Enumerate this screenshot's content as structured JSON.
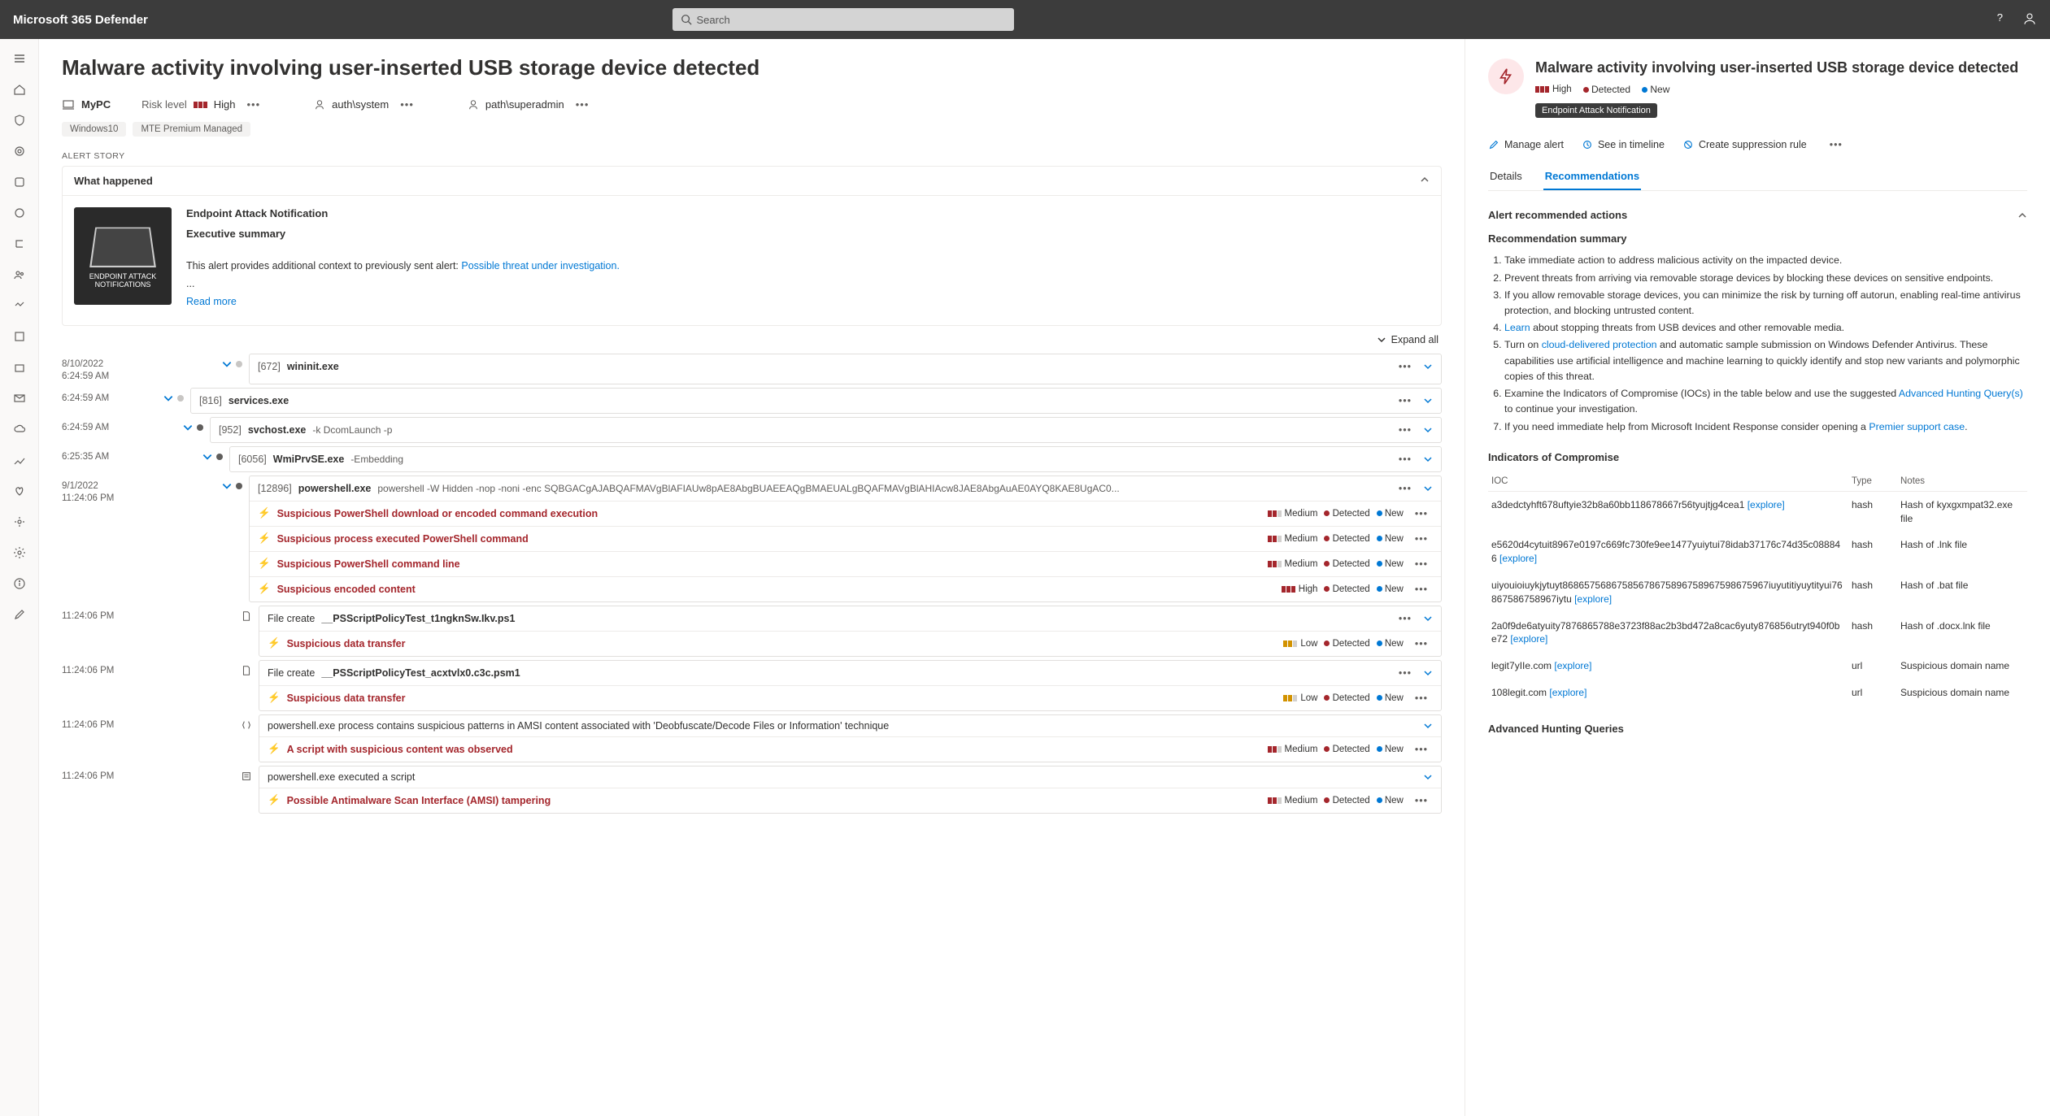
{
  "header": {
    "product": "Microsoft 365 Defender",
    "search_placeholder": "Search"
  },
  "page": {
    "title": "Malware activity involving user-inserted USB storage device detected",
    "device": "MyPC",
    "risk_label": "Risk level",
    "risk_value": "High",
    "user1": "auth\\system",
    "user2": "path\\superadmin",
    "tags": [
      "Windows10",
      "MTE Premium Managed"
    ]
  },
  "story": {
    "section_label": "ALERT STORY",
    "heading": "What happened",
    "ean_title": "Endpoint Attack Notification",
    "exec_sum": "Executive summary",
    "context1": "This alert provides additional context to previously sent alert: ",
    "context_link": "Possible threat under investigation.",
    "ellipsis": "...",
    "read_more": "Read more",
    "expand_all": "Expand all",
    "badge_line1": "ENDPOINT ATTACK",
    "badge_line2": "NOTIFICATIONS"
  },
  "tree": [
    {
      "time1": "8/10/2022",
      "time2": "6:24:59 AM",
      "pid": "[672]",
      "exe": "wininit.exe",
      "args": ""
    },
    {
      "time1": "",
      "time2": "6:24:59 AM",
      "pid": "[816]",
      "exe": "services.exe",
      "args": ""
    },
    {
      "time1": "",
      "time2": "6:24:59 AM",
      "pid": "[952]",
      "exe": "svchost.exe",
      "args": "-k DcomLaunch -p"
    },
    {
      "time1": "",
      "time2": "6:25:35 AM",
      "pid": "[6056]",
      "exe": "WmiPrvSE.exe",
      "args": "-Embedding"
    },
    {
      "time1": "9/1/2022",
      "time2": "11:24:06 PM",
      "pid": "[12896]",
      "exe": "powershell.exe",
      "args": "powershell -W Hidden -nop -noni -enc SQBGACgAJABQAFMAVgBlAFIAUw8pAE8AbgBUAEEAQgBMAEUALgBQAFMAVgBlAHIAcw8JAE8AbgAuAE0AYQ8KAE8UgAC0..."
    }
  ],
  "alerts_ps": [
    {
      "name": "Suspicious PowerShell download or encoded command execution",
      "sev": "Medium",
      "status": "Detected",
      "state": "New"
    },
    {
      "name": "Suspicious process executed PowerShell command",
      "sev": "Medium",
      "status": "Detected",
      "state": "New"
    },
    {
      "name": "Suspicious PowerShell command line",
      "sev": "Medium",
      "status": "Detected",
      "state": "New"
    },
    {
      "name": "Suspicious encoded content",
      "sev": "High",
      "status": "Detected",
      "state": "New"
    }
  ],
  "file1": {
    "time": "11:24:06 PM",
    "head_pre": "File create",
    "head_post": "__PSScriptPolicyTest_t1ngknSw.Ikv.ps1",
    "alert": {
      "name": "Suspicious data transfer",
      "sev": "Low",
      "status": "Detected",
      "state": "New"
    }
  },
  "file2": {
    "time": "11:24:06 PM",
    "head_pre": "File create",
    "head_post": "__PSScriptPolicyTest_acxtvlx0.c3c.psm1",
    "alert": {
      "name": "Suspicious data transfer",
      "sev": "Low",
      "status": "Detected",
      "state": "New"
    }
  },
  "amsi": {
    "time": "11:24:06 PM",
    "head": "powershell.exe process contains suspicious patterns in AMSI content associated with 'Deobfuscate/Decode Files or Information' technique",
    "alert": {
      "name": "A script with suspicious content was observed",
      "sev": "Medium",
      "status": "Detected",
      "state": "New"
    }
  },
  "script": {
    "time": "11:24:06 PM",
    "head": "powershell.exe executed a script",
    "alert": {
      "name": "Possible Antimalware Scan Interface (AMSI) tampering",
      "sev": "Medium",
      "status": "Detected",
      "state": "New"
    }
  },
  "panel": {
    "title": "Malware activity involving user-inserted USB storage device detected",
    "sev": "High",
    "status": "Detected",
    "state": "New",
    "ean_tag": "Endpoint Attack Notification",
    "actions": {
      "manage": "Manage alert",
      "timeline": "See in timeline",
      "suppress": "Create suppression rule"
    },
    "tabs": {
      "details": "Details",
      "recs": "Recommendations"
    },
    "alert_rec_h": "Alert recommended actions",
    "rec_sum_h": "Recommendation summary",
    "recs": [
      {
        "pre": "Take immediate action to address malicious activity on the impacted device."
      },
      {
        "pre": "Prevent threats from arriving via removable storage devices by blocking these devices on sensitive endpoints."
      },
      {
        "pre": "If you allow removable storage devices, you can minimize the risk by turning off autorun, enabling real-time antivirus protection, and blocking untrusted content."
      },
      {
        "link_first": true,
        "link": "Learn",
        "post": " about stopping threats from USB devices and other removable media."
      },
      {
        "pre": "Turn on ",
        "link": "cloud-delivered protection",
        "post": " and automatic sample submission on Windows Defender Antivirus. These capabilities use artificial intelligence and machine learning to quickly identify and stop new variants and polymorphic copies of this threat."
      },
      {
        "pre": "Examine the Indicators of Compromise (IOCs) in the table below and use the suggested ",
        "link": "Advanced Hunting Query(s)",
        "post": " to continue your investigation."
      },
      {
        "pre": "If you need immediate help from Microsoft Incident Response consider opening a ",
        "link": "Premier support case",
        "post": "."
      }
    ],
    "ioc_h": "Indicators of Compromise",
    "ioc_cols": {
      "ioc": "IOC",
      "type": "Type",
      "notes": "Notes"
    },
    "ioc": [
      {
        "ioc": "a3dedctyhft678uftyie32b8a60bb118678667r56tyujtjg4cea1",
        "type": "hash",
        "notes": "Hash of kyxgxmpat32.exe file"
      },
      {
        "ioc": "e5620d4cytuit8967e0197c669fc730fe9ee1477yuiytui78idab37176c74d35c088846",
        "type": "hash",
        "notes": "Hash of <FILE_NAME>.lnk file"
      },
      {
        "ioc": "uiyouioiuykjytuyt86865756867585678675896758967598675967iuyutitiyuytityui76867586758967iytu",
        "type": "hash",
        "notes": "Hash of <FILE_NAME>.bat file"
      },
      {
        "ioc": "2a0f9de6atyuity7876865788e3723f88ac2b3bd472a8cac6yuty876856utryt940f0be72",
        "type": "hash",
        "notes": "Hash of <FILE_NAME>.docx.lnk file"
      },
      {
        "ioc": "legit7yIIe.com",
        "type": "url",
        "notes": "Suspicious domain name"
      },
      {
        "ioc": "108legit.com",
        "type": "url",
        "notes": "Suspicious domain name"
      }
    ],
    "explore": "[explore]",
    "ahq_h": "Advanced Hunting Queries"
  }
}
